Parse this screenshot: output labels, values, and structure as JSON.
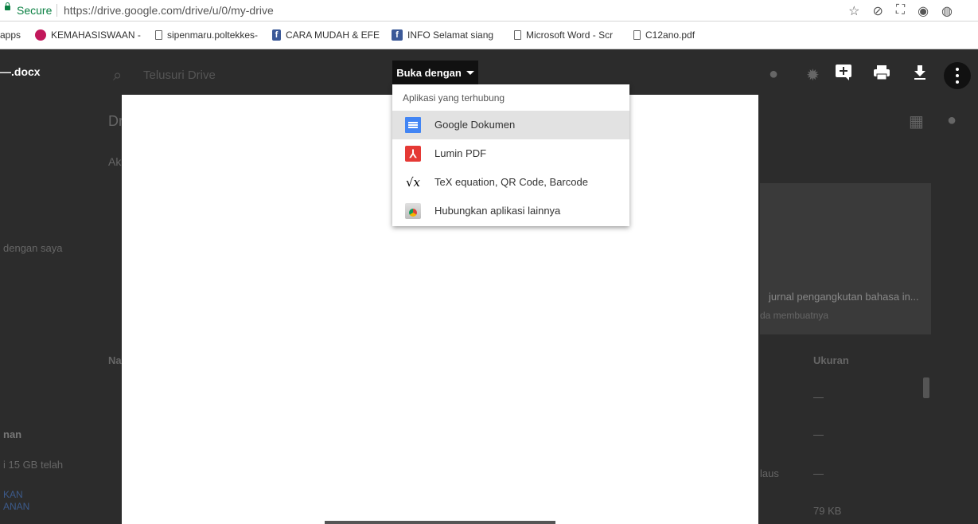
{
  "browser": {
    "secure_label": "Secure",
    "url": "https://drive.google.com/drive/u/0/my-drive"
  },
  "bookmarks": [
    {
      "label": "apps"
    },
    {
      "label": "KEMAHASISWAAN -"
    },
    {
      "label": "sipenmaru.poltekkes-"
    },
    {
      "label": "CARA MUDAH & EFE"
    },
    {
      "label": "INFO Selamat siang"
    },
    {
      "label": "Microsoft Word - Scr"
    },
    {
      "label": "C12ano.pdf"
    }
  ],
  "background": {
    "search_placeholder": "Telusuri Drive",
    "drive_title": "Dr",
    "access_label": "Ak",
    "sidebar_shared": "dengan saya",
    "sidebar_storage_title": "nan",
    "sidebar_storage_text": "i 15 GB telah",
    "sidebar_upgrade_1": "KAN",
    "sidebar_upgrade_2": "ANAN",
    "card_title": "jurnal pengangkutan bahasa in...",
    "card_sub": "da membuatnya",
    "col_name": "Na",
    "col_size": "Ukuran",
    "row_dashes": "—",
    "row_size": "79 KB",
    "row_partial": "laus"
  },
  "viewer": {
    "file_name": "—.docx",
    "open_with_label": "Buka dengan"
  },
  "menu": {
    "heading": "Aplikasi yang terhubung",
    "items": [
      {
        "label": "Google Dokumen",
        "icon": "google-docs-icon",
        "selected": true
      },
      {
        "label": "Lumin PDF",
        "icon": "lumin-pdf-icon",
        "selected": false
      },
      {
        "label": "TeX equation, QR Code, Barcode",
        "icon": "tex-equation-icon",
        "selected": false
      },
      {
        "label": "Hubungkan aplikasi lainnya",
        "icon": "chrome-web-store-icon",
        "selected": false
      }
    ]
  }
}
